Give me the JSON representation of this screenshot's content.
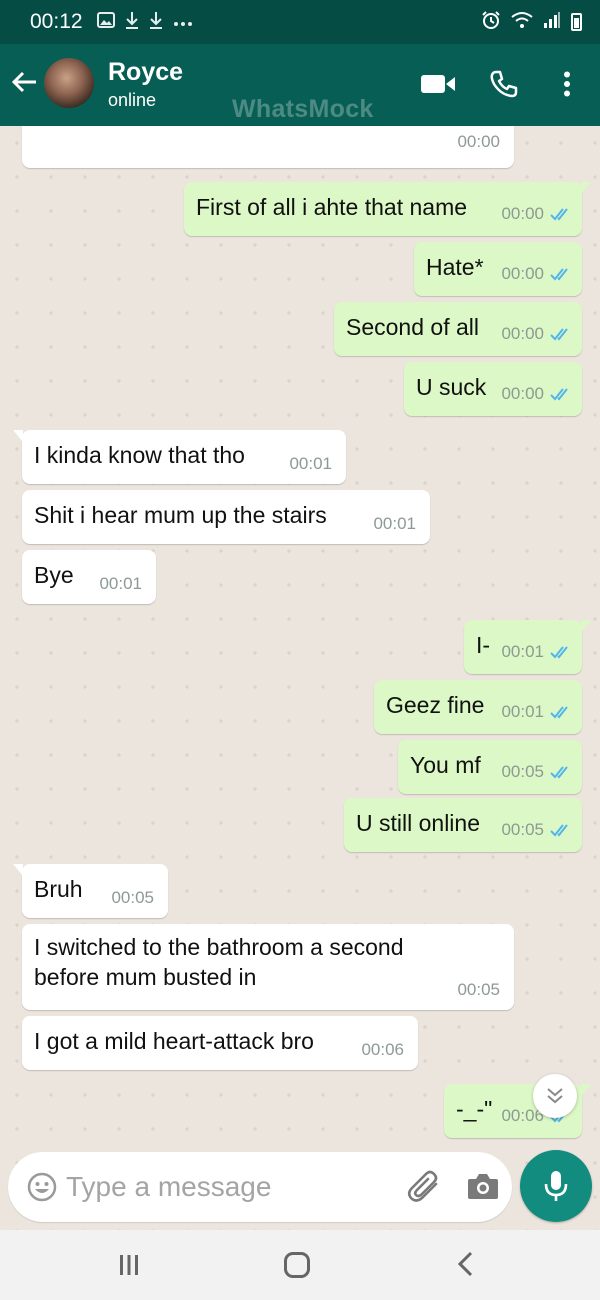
{
  "status_bar": {
    "time": "00:12",
    "left_icons": [
      "gallery-icon",
      "download-icon",
      "download-icon",
      "more-dots-icon"
    ],
    "right_icons": [
      "alarm-icon",
      "wifi-icon",
      "signal-icon",
      "battery-icon"
    ]
  },
  "header": {
    "contact_name": "Royce",
    "contact_status": "online",
    "watermark": "WhatsMock"
  },
  "messages": [
    {
      "dir": "in",
      "text": "",
      "time": "00:00"
    },
    {
      "dir": "out",
      "text": "First of all i ahte that name",
      "time": "00:00"
    },
    {
      "dir": "out",
      "text": "Hate*",
      "time": "00:00"
    },
    {
      "dir": "out",
      "text": "Second of all",
      "time": "00:00"
    },
    {
      "dir": "out",
      "text": "U suck",
      "time": "00:00"
    },
    {
      "dir": "in",
      "text": "I kinda know that tho",
      "time": "00:01"
    },
    {
      "dir": "in",
      "text": "Shit i hear mum up the stairs",
      "time": "00:01"
    },
    {
      "dir": "in",
      "text": "Bye",
      "time": "00:01"
    },
    {
      "dir": "out",
      "text": "I-",
      "time": "00:01"
    },
    {
      "dir": "out",
      "text": "Geez fine",
      "time": "00:01"
    },
    {
      "dir": "out",
      "text": "You mf",
      "time": "00:05"
    },
    {
      "dir": "out",
      "text": "U still online",
      "time": "00:05"
    },
    {
      "dir": "in",
      "text": "Bruh",
      "time": "00:05"
    },
    {
      "dir": "in",
      "text": "I switched to the bathroom a second before mum busted in",
      "time": "00:05"
    },
    {
      "dir": "in",
      "text": "I got a mild heart-attack bro",
      "time": "00:06"
    },
    {
      "dir": "out",
      "text": "-_-\"",
      "time": "00:06"
    }
  ],
  "composer": {
    "placeholder": "Type a message"
  },
  "colors": {
    "header": "#075e54",
    "status_bar": "#054d44",
    "outgoing_bubble": "#dcf8c6",
    "incoming_bubble": "#ffffff",
    "read_ticks": "#4fb6ec",
    "mic_button": "#128c7e",
    "chat_background": "#ece5dd"
  }
}
